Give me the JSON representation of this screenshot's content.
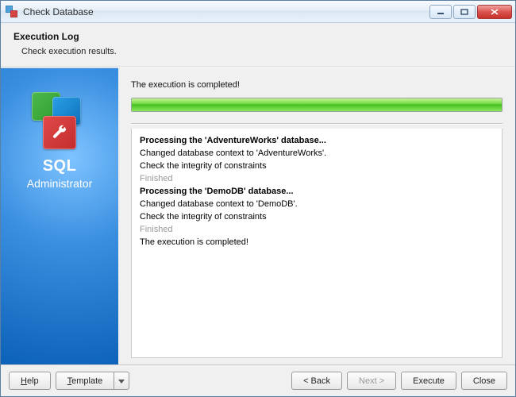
{
  "window": {
    "title": "Check Database"
  },
  "header": {
    "title": "Execution Log",
    "subtitle": "Check execution results."
  },
  "sidebar": {
    "product_line1": "SQL",
    "product_line2": "Administrator"
  },
  "main": {
    "status": "The execution is completed!",
    "progress_percent": 100,
    "log": [
      {
        "text": "Processing the 'AdventureWorks' database...",
        "style": "bold"
      },
      {
        "text": "Changed database context to 'AdventureWorks'.",
        "style": "normal"
      },
      {
        "text": "Check the integrity of constraints",
        "style": "normal"
      },
      {
        "text": "Finished",
        "style": "gray"
      },
      {
        "text": "Processing the 'DemoDB' database...",
        "style": "bold"
      },
      {
        "text": "Changed database context to 'DemoDB'.",
        "style": "normal"
      },
      {
        "text": "Check the integrity of constraints",
        "style": "normal"
      },
      {
        "text": "Finished",
        "style": "gray"
      },
      {
        "text": "The execution is completed!",
        "style": "normal"
      }
    ]
  },
  "footer": {
    "help": "Help",
    "template": "Template",
    "back": "< Back",
    "next": "Next >",
    "execute": "Execute",
    "close": "Close",
    "next_enabled": false
  }
}
